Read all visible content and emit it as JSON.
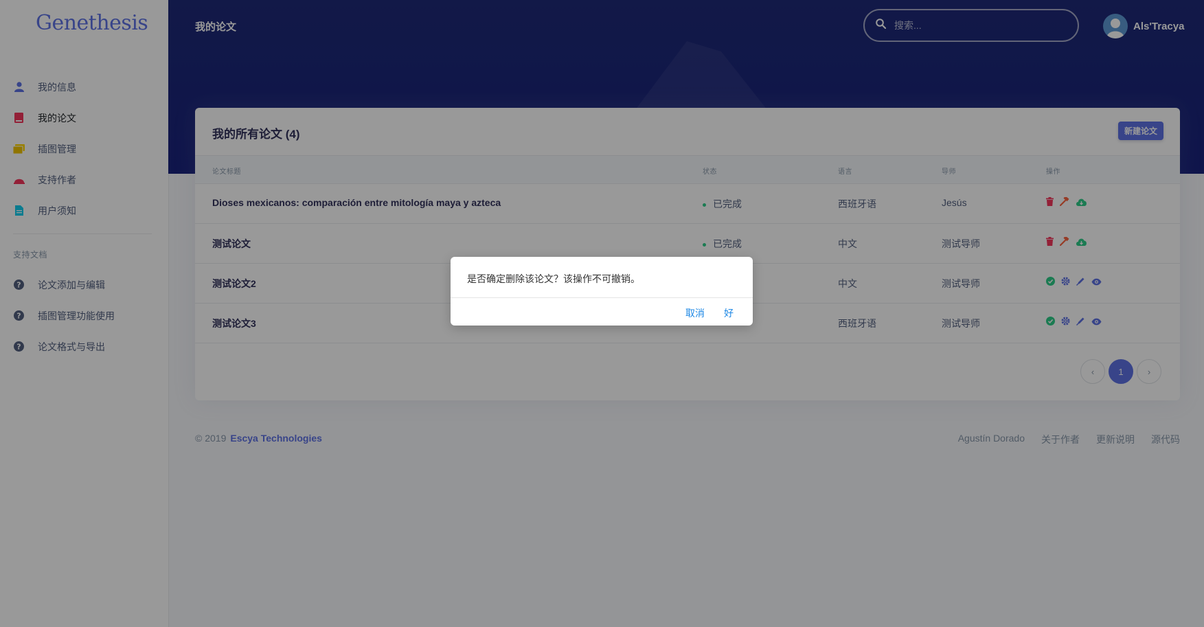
{
  "app": {
    "brand": "Genethesis",
    "page_title": "我的论文"
  },
  "sidebar": {
    "items": [
      {
        "label": "我的信息",
        "icon": "user-icon",
        "color": "#5e72e4"
      },
      {
        "label": "我的论文",
        "icon": "book-icon",
        "color": "#f5365c",
        "active": true
      },
      {
        "label": "插图管理",
        "icon": "images-icon",
        "color": "#ffd600"
      },
      {
        "label": "支持作者",
        "icon": "bell-icon",
        "color": "#f5365c"
      },
      {
        "label": "用户须知",
        "icon": "document-icon",
        "color": "#11cdef"
      }
    ],
    "docs_heading": "支持文档",
    "docs": [
      {
        "label": "论文添加与编辑",
        "icon": "question-icon"
      },
      {
        "label": "插图管理功能使用",
        "icon": "question-icon"
      },
      {
        "label": "论文格式与导出",
        "icon": "question-icon"
      }
    ]
  },
  "header": {
    "search_placeholder": "搜索...",
    "user_name": "Als'Tracya"
  },
  "card": {
    "title": "我的所有论文 (4)",
    "new_button": "新建论文",
    "columns": [
      "论文标题",
      "状态",
      "语言",
      "导师",
      "操作"
    ],
    "rows": [
      {
        "title": "Dioses mexicanos: comparación entre mitología maya y azteca",
        "status": "已完成",
        "language": "西班牙语",
        "advisor": "Jesús",
        "actions": "completed"
      },
      {
        "title": "测试论文",
        "status": "已完成",
        "language": "中文",
        "advisor": "测试导师",
        "actions": "completed"
      },
      {
        "title": "测试论文2",
        "status": "",
        "language": "中文",
        "advisor": "测试导师",
        "actions": "editing"
      },
      {
        "title": "测试论文3",
        "status": "",
        "language": "西班牙语",
        "advisor": "测试导师",
        "actions": "editing"
      }
    ],
    "pagination": {
      "current": "1"
    }
  },
  "footer": {
    "copyright": "© 2019",
    "company": "Escya Technologies",
    "links": [
      "Agustín Dorado",
      "关于作者",
      "更新说明",
      "源代码"
    ]
  },
  "dialog": {
    "message": "是否确定删除该论文？该操作不可撤销。",
    "cancel": "取消",
    "ok": "好"
  },
  "colors": {
    "accent": "#5e72e4",
    "success": "#2dce89",
    "danger": "#f5365c",
    "header": "#1a237e"
  }
}
